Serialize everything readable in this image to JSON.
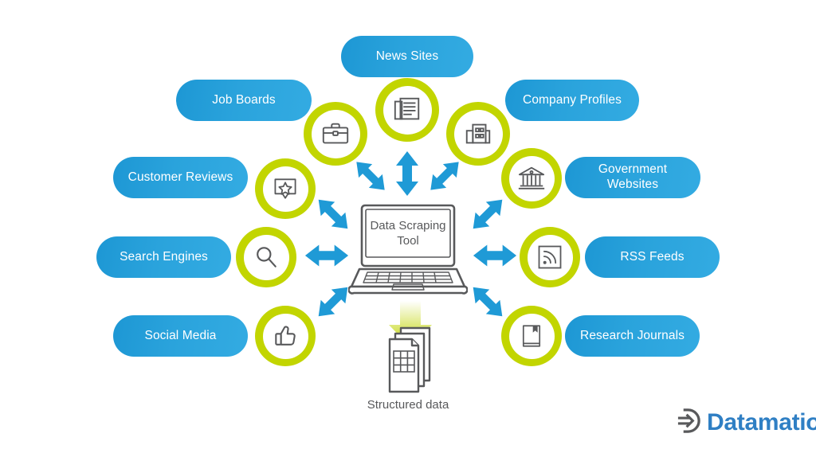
{
  "diagram": {
    "center": {
      "label": "Data Scraping\nTool",
      "label_line1": "Data Scraping",
      "label_line2": "Tool",
      "icon": "laptop-icon"
    },
    "output": {
      "label": "Structured data",
      "icon": "documents-stack-icon",
      "arrow_icon": "down-arrow-icon"
    },
    "sources": [
      {
        "id": "news-sites",
        "label": "News Sites",
        "icon": "newspaper-icon",
        "position": "top-center"
      },
      {
        "id": "job-boards",
        "label": "Job Boards",
        "icon": "briefcase-icon",
        "position": "top-left"
      },
      {
        "id": "company-profiles",
        "label": "Company Profiles",
        "icon": "office-building-icon",
        "position": "top-right"
      },
      {
        "id": "customer-reviews",
        "label": "Customer Reviews",
        "icon": "review-star-icon",
        "position": "left-upper"
      },
      {
        "id": "search-engines",
        "label": "Search Engines",
        "icon": "magnifier-icon",
        "position": "left-middle"
      },
      {
        "id": "social-media",
        "label": "Social Media",
        "icon": "thumbs-up-icon",
        "position": "left-lower"
      },
      {
        "id": "government-websites",
        "label": "Government\nWebsites",
        "label_line1": "Government",
        "label_line2": "Websites",
        "icon": "bank-building-icon",
        "position": "right-upper"
      },
      {
        "id": "rss-feeds",
        "label": "RSS Feeds",
        "icon": "rss-icon",
        "position": "right-middle"
      },
      {
        "id": "research-journals",
        "label": "Research Journals",
        "icon": "book-icon",
        "position": "right-lower"
      }
    ],
    "connectors": [
      {
        "id": "conn-job-boards",
        "direction": "diagonal-up-left",
        "double_headed": true
      },
      {
        "id": "conn-news-sites",
        "direction": "vertical",
        "double_headed": true
      },
      {
        "id": "conn-company-profiles",
        "direction": "diagonal-up-right",
        "double_headed": true
      },
      {
        "id": "conn-customer-reviews",
        "direction": "diagonal-up-left",
        "double_headed": true
      },
      {
        "id": "conn-search-engines",
        "direction": "horizontal",
        "double_headed": true
      },
      {
        "id": "conn-social-media",
        "direction": "diagonal-down-left",
        "double_headed": true
      },
      {
        "id": "conn-government",
        "direction": "diagonal-up-right",
        "double_headed": true
      },
      {
        "id": "conn-rss",
        "direction": "horizontal",
        "double_headed": true
      },
      {
        "id": "conn-journals",
        "direction": "diagonal-down-right",
        "double_headed": true
      }
    ]
  },
  "branding": {
    "logo_text": "Datamation",
    "logo_icon": "datamation-d-arrow-icon"
  },
  "colors": {
    "pill_blue_start": "#1d97d4",
    "pill_blue_end": "#33abe2",
    "ring_green": "#c2d500",
    "icon_gray": "#58595b",
    "arrow_blue": "#1f9ad6",
    "logo_blue": "#2f7fc4",
    "logo_dark": "#58595b",
    "background": "#ffffff",
    "output_arrow_gradient_top": "#ffffff",
    "output_arrow_gradient_bottom": "#c2d500"
  }
}
